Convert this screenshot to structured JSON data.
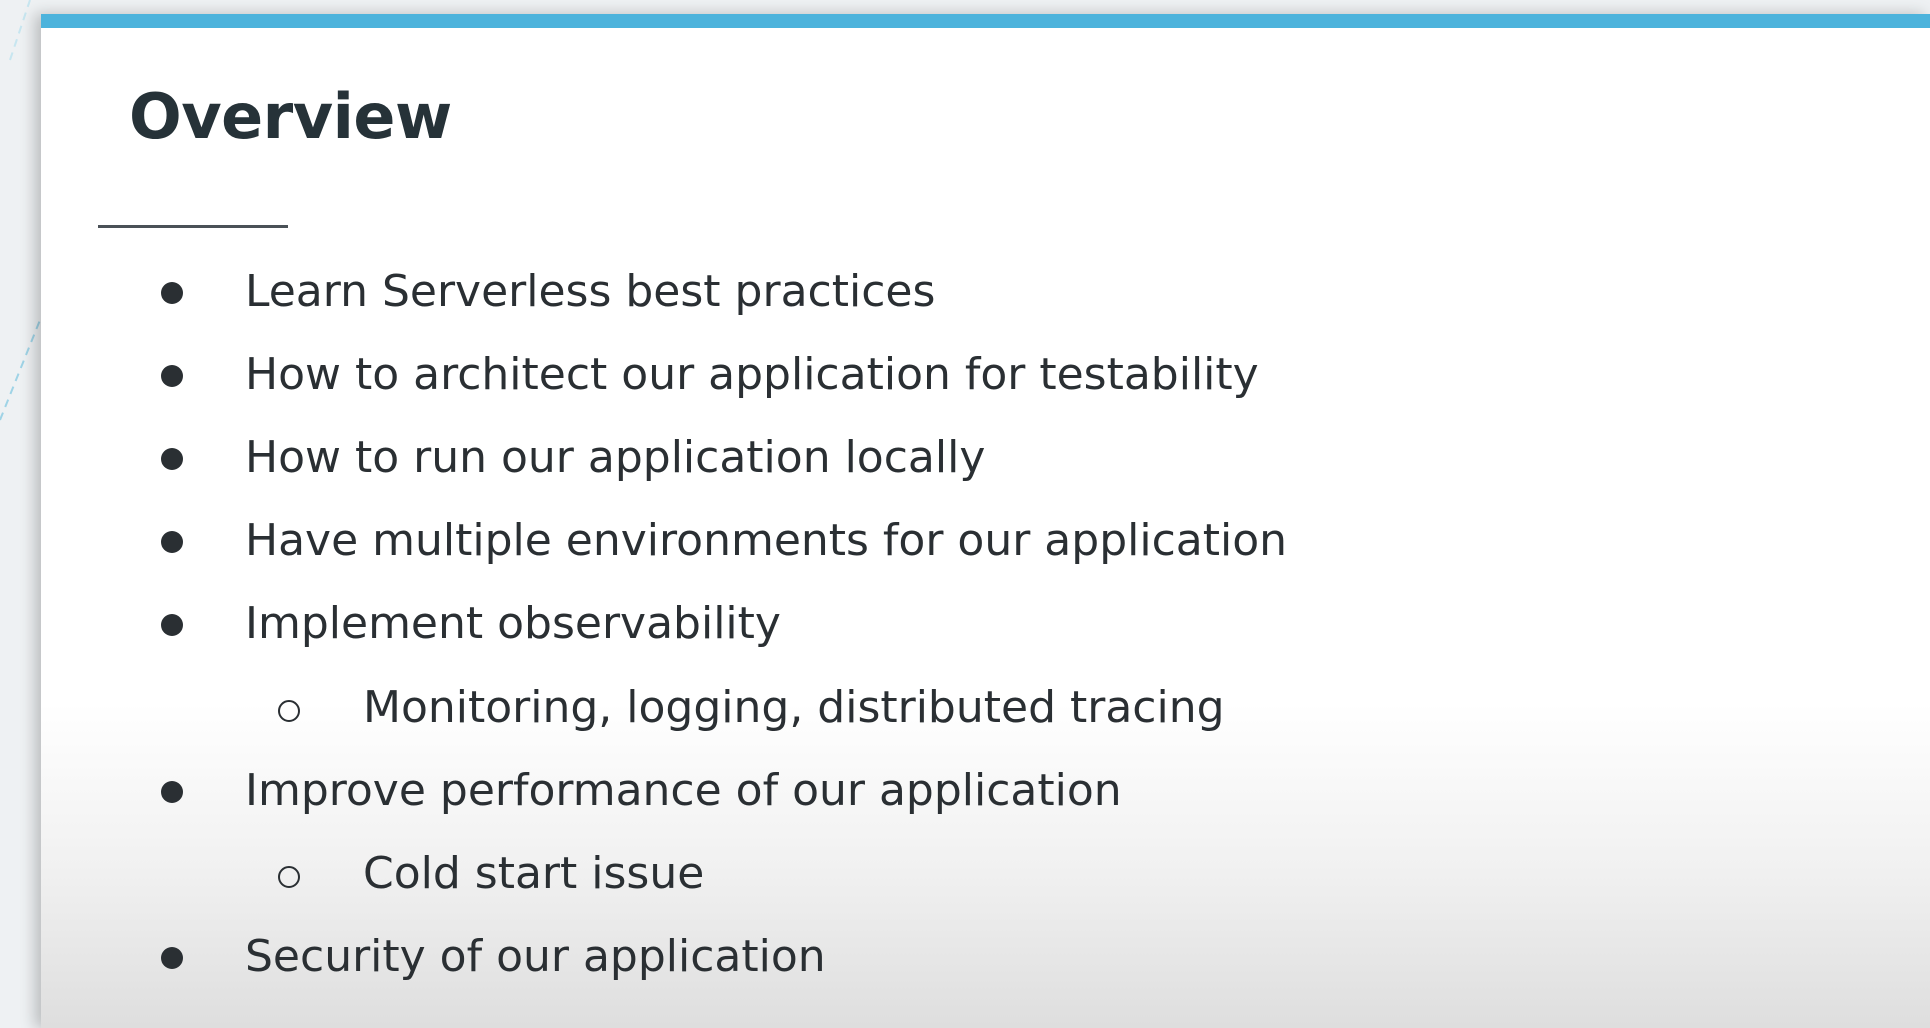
{
  "slide": {
    "title": "Overview",
    "accent_color": "#4cb3dc",
    "items": [
      {
        "level": 1,
        "text": "Learn Serverless best practices"
      },
      {
        "level": 1,
        "text": "How to architect our application for testability"
      },
      {
        "level": 1,
        "text": "How to run our application locally"
      },
      {
        "level": 1,
        "text": "Have multiple environments for our application"
      },
      {
        "level": 1,
        "text": "Implement observability"
      },
      {
        "level": 2,
        "text": "Monitoring, logging, distributed tracing"
      },
      {
        "level": 1,
        "text": "Improve performance of our application"
      },
      {
        "level": 2,
        "text": "Cold start issue"
      },
      {
        "level": 1,
        "text": "Security of our application"
      }
    ]
  }
}
